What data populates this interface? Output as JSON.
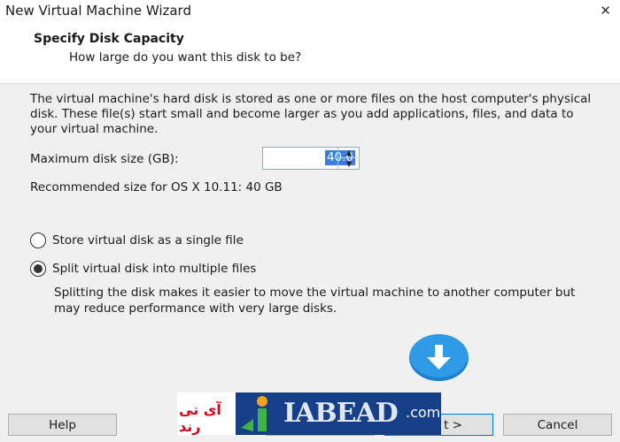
{
  "window": {
    "title": "New Virtual Machine Wizard",
    "close_glyph": "✕"
  },
  "header": {
    "title": "Specify Disk Capacity",
    "subtitle": "How large do you want this disk to be?"
  },
  "description": "The virtual machine's hard disk is stored as one or more files on the host computer's physical disk. These file(s) start small and become larger as you add applications, files, and data to your virtual machine.",
  "disk_size": {
    "label": "Maximum disk size (GB):",
    "value": "40.0"
  },
  "recommendation": "Recommended size for OS X 10.11: 40 GB",
  "options": [
    {
      "label": "Store virtual disk as a single file",
      "checked": false
    },
    {
      "label": "Split virtual disk into multiple files",
      "checked": true
    }
  ],
  "split_note": "Splitting the disk makes it easier to move the virtual machine to another computer but may reduce performance with very large disks.",
  "buttons": {
    "help": "Help",
    "back": "",
    "next": "t >",
    "cancel": "Cancel"
  },
  "watermark": {
    "persian": "آی تی رند",
    "latin": "IABEAD",
    "suffix": ".com"
  },
  "colors": {
    "accent": "#0078d7",
    "selection": "#3a7de0",
    "download_icon": "#2f9be6",
    "watermark_bg": "#153f86",
    "watermark_red": "#d0021b"
  }
}
